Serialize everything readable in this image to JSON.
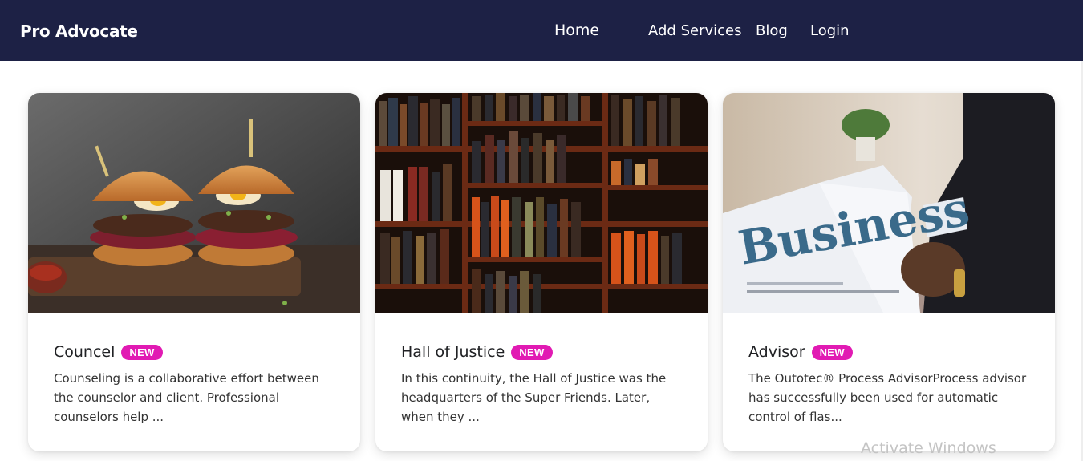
{
  "navbar": {
    "brand": "Pro Advocate",
    "links": [
      "Home",
      "Add Services",
      "Blog",
      "Login"
    ]
  },
  "cards": [
    {
      "title": "Councel",
      "badge": "NEW",
      "text": "Counseling is a collaborative effort between the counselor and client. Professional counselors help ...",
      "image": "burgers-photo"
    },
    {
      "title": "Hall of Justice",
      "badge": "NEW",
      "text": "In this continuity, the Hall of Justice was the headquarters of the Super Friends. Later, when they ...",
      "image": "bookshelf-photo"
    },
    {
      "title": "Advisor",
      "badge": "NEW",
      "text": "The Outotec® Process AdvisorProcess advisor has successfully been used for automatic control of flas...",
      "image": "business-newspaper-photo",
      "image_text": "Business"
    }
  ],
  "watermark": "Activate Windows",
  "colors": {
    "navbar": "#1d2145",
    "badge": "#e11ab3"
  }
}
